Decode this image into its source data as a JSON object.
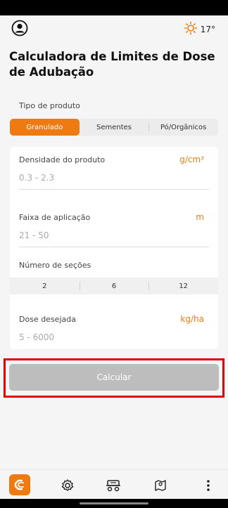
{
  "header": {
    "weather_temp": "17°"
  },
  "page": {
    "title": "Calculadora de Limites de Dose de Adubação"
  },
  "product_type": {
    "label": "Tipo de produto",
    "options": [
      "Granulado",
      "Sementes",
      "Pó/Orgânicos"
    ],
    "selected": "Granulado"
  },
  "fields": {
    "density": {
      "label": "Densidade do produto",
      "unit": "g/cm³",
      "placeholder": "0.3 - 2.3"
    },
    "application_range": {
      "label": "Faixa de aplicação",
      "unit": "m",
      "placeholder": "21 - 50"
    },
    "sections": {
      "label": "Número de seções",
      "options": [
        "2",
        "6",
        "12"
      ]
    },
    "dose": {
      "label": "Dose desejada",
      "unit": "kg/ha",
      "placeholder": "5 - 6000"
    }
  },
  "actions": {
    "calculate_label": "Calcular"
  },
  "bottom_nav": {
    "items": [
      "logo-icon",
      "settings-gear-icon",
      "machine-icon",
      "map-pin-icon",
      "more-vertical-icon"
    ]
  },
  "colors": {
    "accent": "#f07a12",
    "highlight": "#e00000",
    "disabled_button": "#bdbdbd"
  }
}
